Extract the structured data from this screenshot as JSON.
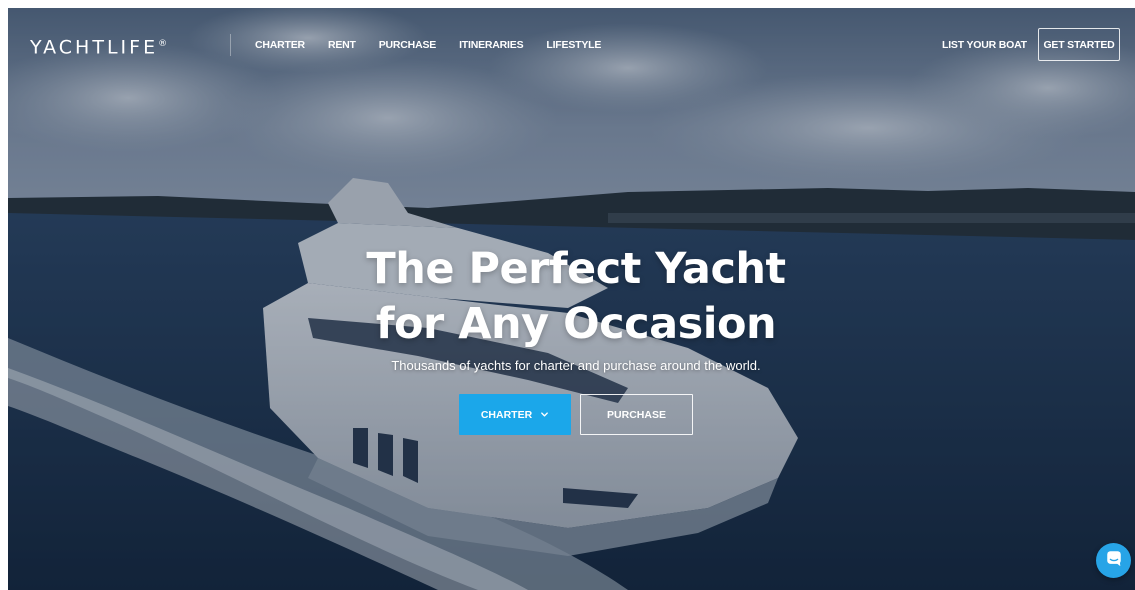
{
  "header": {
    "logo": "YACHTLIFE",
    "logo_mark": "®",
    "nav": [
      {
        "label": "CHARTER"
      },
      {
        "label": "RENT"
      },
      {
        "label": "PURCHASE"
      },
      {
        "label": "ITINERARIES"
      },
      {
        "label": "LIFESTYLE"
      }
    ],
    "list_your_boat": "LIST YOUR BOAT",
    "get_started": "GET STARTED"
  },
  "hero": {
    "title_line1": "The Perfect Yacht",
    "title_line2": "for Any Occasion",
    "subtitle": "Thousands of yachts for charter and purchase around the world.",
    "cta_charter": "CHARTER",
    "cta_purchase": "PURCHASE"
  },
  "icons": {
    "charter_dropdown": "chevron-down-icon",
    "chat": "chat-bubble-icon"
  },
  "colors": {
    "accent": "#1ba7ea",
    "chat": "#27a4e7",
    "text": "#ffffff"
  }
}
